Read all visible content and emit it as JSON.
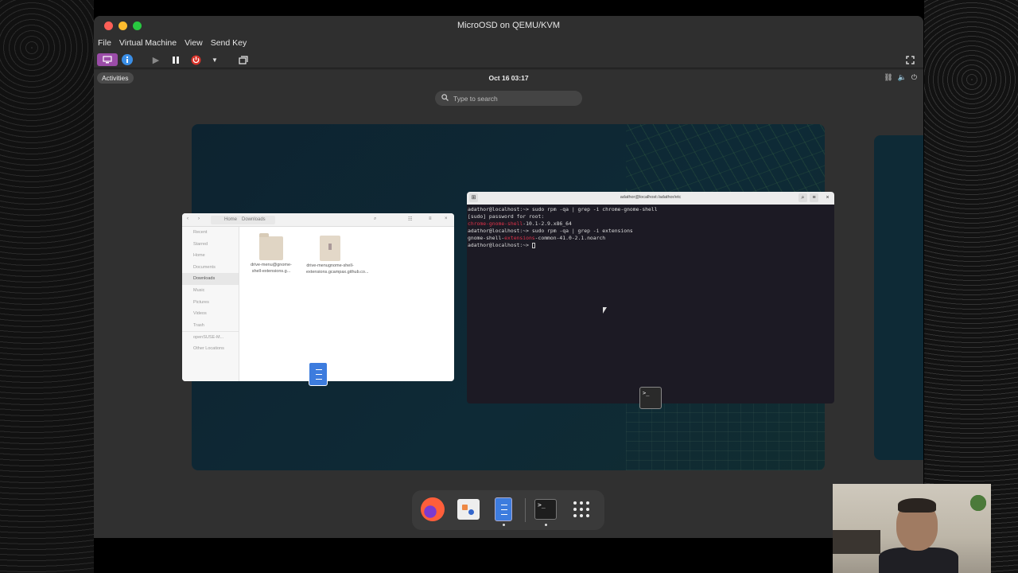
{
  "window": {
    "title": "MicroOSD on QEMU/KVM"
  },
  "menubar": [
    "File",
    "Virtual Machine",
    "View",
    "Send Key"
  ],
  "guest": {
    "activities": "Activities",
    "clock": "Oct 16  03:17",
    "search_placeholder": "Type to search"
  },
  "files": {
    "path_home": "Home",
    "path_downloads": "Downloads",
    "sidebar": [
      "Recent",
      "Starred",
      "Home",
      "Documents",
      "Downloads",
      "Music",
      "Pictures",
      "Videos",
      "Trash",
      "openSUSE-M...",
      "Other Locations"
    ],
    "items": [
      {
        "name": "drive-menu@gnome-shell-extensions.g...",
        "type": "folder"
      },
      {
        "name": "drive-menugnome-shell-extensions.gcampax.github.co...",
        "type": "archive"
      }
    ]
  },
  "terminal": {
    "title": "adathor@localhost:/adathor/etc",
    "lines": [
      {
        "prompt": "adathor@localhost:~> ",
        "cmd": "sudo rpm -qa | grep -i chrome-gnome-shell"
      },
      {
        "text": "[sudo] password for root:"
      },
      {
        "red": "chrome-gnome-shell",
        "rest": "-10.1-2.9.x86_64"
      },
      {
        "prompt": "adathor@localhost:~> ",
        "cmd": "sudo rpm -qa | grep -i extensions"
      },
      {
        "pre": "gnome-shell-",
        "red": "extensions",
        "rest": "-common-41.0-2.1.noarch"
      },
      {
        "prompt": "adathor@localhost:~> ",
        "cmd": ""
      }
    ]
  },
  "dock": [
    "firefox-icon",
    "software-icon",
    "files-icon",
    "terminal-icon",
    "app-grid-icon"
  ],
  "colors": {
    "red_light": "#fe5f57",
    "yellow_light": "#febc2e",
    "green_light": "#28c840",
    "accent_purple": "#9b4ca8",
    "terminal_red": "#e0334a"
  }
}
